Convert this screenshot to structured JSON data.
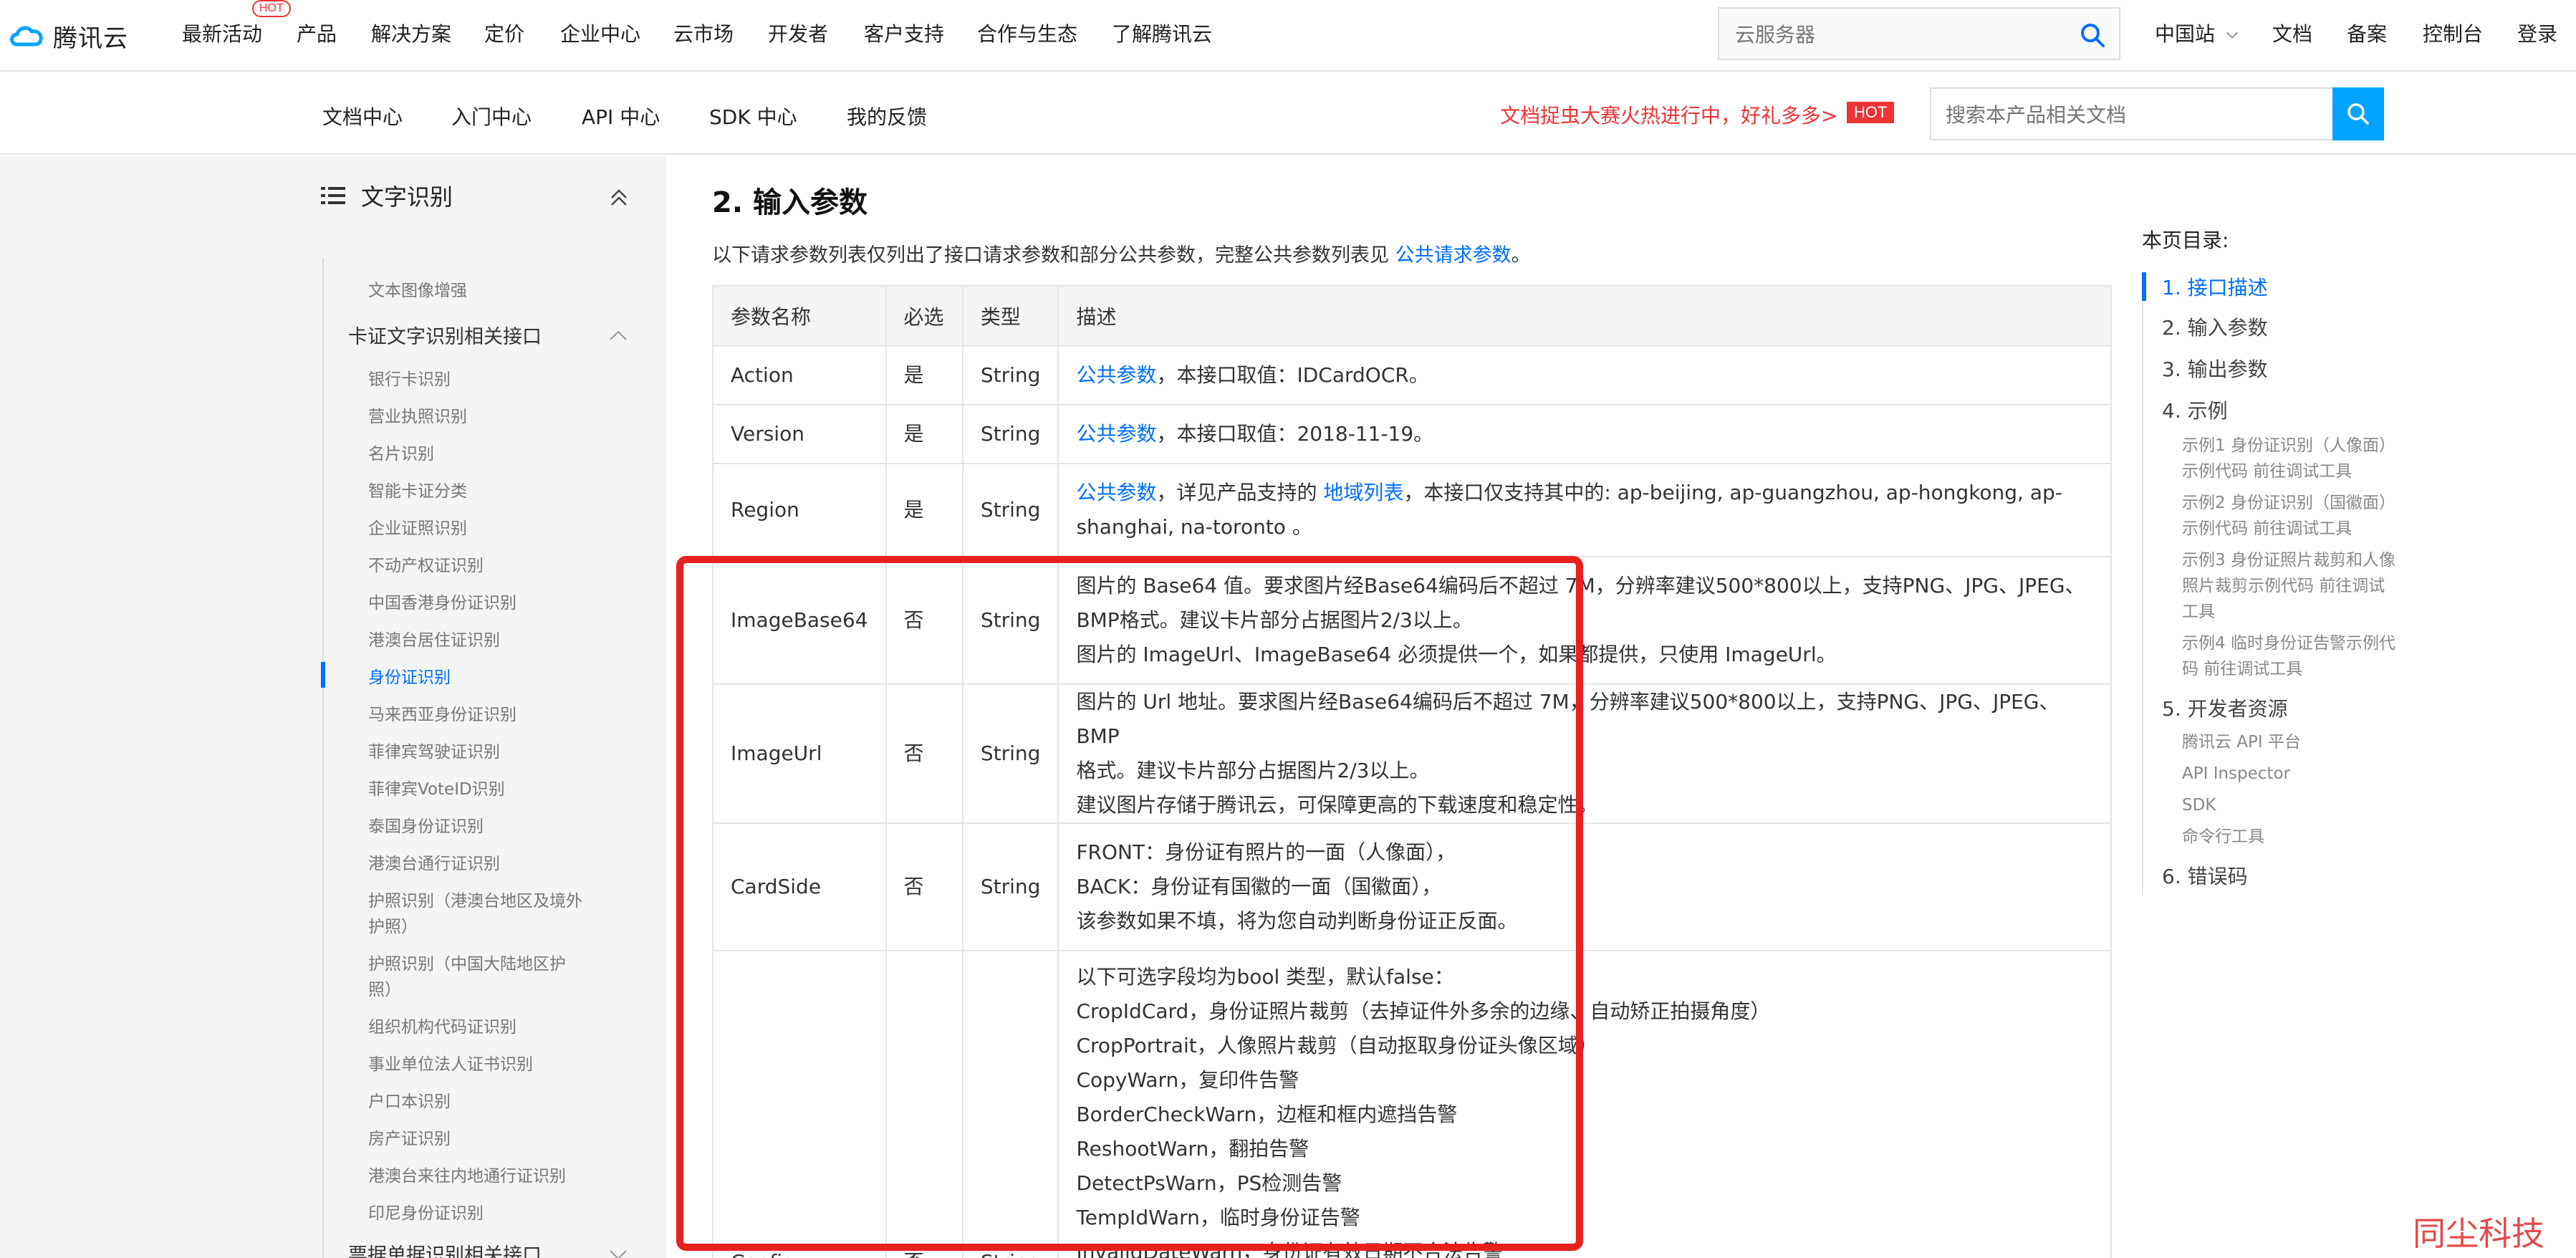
{
  "brand": {
    "name": "腾讯云",
    "accent": "#006eff",
    "highlight_color": "#e8201e"
  },
  "topnav": {
    "items": [
      "最新活动",
      "产品",
      "解决方案",
      "定价",
      "企业中心",
      "云市场",
      "开发者",
      "客户支持",
      "合作与生态",
      "了解腾讯云"
    ],
    "hot_badge": "HOT",
    "search_placeholder": "云服务器",
    "right": [
      "中国站",
      "文档",
      "备案",
      "控制台",
      "登录"
    ]
  },
  "subnav": {
    "items": [
      "文档中心",
      "入门中心",
      "API 中心",
      "SDK 中心",
      "我的反馈"
    ],
    "promo": "文档捉虫大赛火热进行中，好礼多多>",
    "promo_badge": "HOT",
    "search_placeholder": "搜索本产品相关文档"
  },
  "sidebar": {
    "title": "文字识别",
    "items": [
      {
        "label": "文本图像增强",
        "type": "item"
      },
      {
        "label": "卡证文字识别相关接口",
        "type": "group"
      },
      {
        "label": "银行卡识别",
        "type": "item"
      },
      {
        "label": "营业执照识别",
        "type": "item"
      },
      {
        "label": "名片识别",
        "type": "item"
      },
      {
        "label": "智能卡证分类",
        "type": "item"
      },
      {
        "label": "企业证照识别",
        "type": "item"
      },
      {
        "label": "不动产权证识别",
        "type": "item"
      },
      {
        "label": "中国香港身份证识别",
        "type": "item"
      },
      {
        "label": "港澳台居住证识别",
        "type": "item"
      },
      {
        "label": "身份证识别",
        "type": "item",
        "active": true
      },
      {
        "label": "马来西亚身份证识别",
        "type": "item"
      },
      {
        "label": "菲律宾驾驶证识别",
        "type": "item"
      },
      {
        "label": "菲律宾VoteID识别",
        "type": "item"
      },
      {
        "label": "泰国身份证识别",
        "type": "item"
      },
      {
        "label": "港澳台通行证识别",
        "type": "item"
      },
      {
        "label": "护照识别（港澳台地区及境外",
        "label2": "护照）",
        "type": "item"
      },
      {
        "label": "护照识别（中国大陆地区护",
        "label2": "照）",
        "type": "item"
      },
      {
        "label": "组织机构代码证识别",
        "type": "item"
      },
      {
        "label": "事业单位法人证书识别",
        "type": "item"
      },
      {
        "label": "户口本识别",
        "type": "item"
      },
      {
        "label": "房产证识别",
        "type": "item"
      },
      {
        "label": "港澳台来往内地通行证识别",
        "type": "item"
      },
      {
        "label": "印尼身份证识别",
        "type": "item"
      },
      {
        "label": "票据单据识别相关接口",
        "type": "group"
      }
    ]
  },
  "content": {
    "heading": "2. 输入参数",
    "intro_before": "以下请求参数列表仅列出了接口请求参数和部分公共参数，完整公共参数列表见 ",
    "intro_link": "公共请求参数",
    "intro_after": "。",
    "table": {
      "headers": [
        "参数名称",
        "必选",
        "类型",
        "描述"
      ],
      "rows": [
        {
          "name": "Action",
          "req": "是",
          "type": "String",
          "desc": [
            {
              "link": "公共参数",
              "text": "，本接口取值：IDCardOCR。"
            }
          ]
        },
        {
          "name": "Version",
          "req": "是",
          "type": "String",
          "desc": [
            {
              "link": "公共参数",
              "text": "，本接口取值：2018-11-19。"
            }
          ]
        },
        {
          "name": "Region",
          "req": "是",
          "type": "String",
          "desc": [
            {
              "link": "公共参数",
              "text": "，详见产品支持的 ",
              "link2": "地域列表",
              "text2": "，本接口仅支持其中的: ap-beijing, ap-guangzhou, ap-hongkong, ap-"
            },
            {
              "text": "shanghai, na-toronto 。"
            }
          ]
        },
        {
          "name": "ImageBase64",
          "req": "否",
          "type": "String",
          "desc": [
            {
              "text": "图片的 Base64 值。要求图片经Base64编码后不超过 7M，分辨率建议500*800以上，支持PNG、JPG、JPEG、"
            },
            {
              "text": "BMP格式。建议卡片部分占据图片2/3以上。"
            },
            {
              "text": "图片的 ImageUrl、ImageBase64 必须提供一个，如果都提供，只使用 ImageUrl。"
            }
          ]
        },
        {
          "name": "ImageUrl",
          "req": "否",
          "type": "String",
          "desc": [
            {
              "text": "图片的 Url 地址。要求图片经Base64编码后不超过 7M，分辨率建议500*800以上，支持PNG、JPG、JPEG、BMP"
            },
            {
              "text": "格式。建议卡片部分占据图片2/3以上。"
            },
            {
              "text": "建议图片存储于腾讯云，可保障更高的下载速度和稳定性。"
            }
          ]
        },
        {
          "name": "CardSide",
          "req": "否",
          "type": "String",
          "desc": [
            {
              "text": "FRONT：身份证有照片的一面（人像面），"
            },
            {
              "text": "BACK：身份证有国徽的一面（国徽面），"
            },
            {
              "text": "该参数如果不填，将为您自动判断身份证正反面。"
            }
          ]
        },
        {
          "name": "Config",
          "req": "否",
          "type": "String",
          "desc": [
            {
              "text": "以下可选字段均为bool 类型，默认false："
            },
            {
              "text": "CropIdCard，身份证照片裁剪（去掉证件外多余的边缘、自动矫正拍摄角度）"
            },
            {
              "text": "CropPortrait，人像照片裁剪（自动抠取身份证头像区域）"
            },
            {
              "text": "CopyWarn，复印件告警"
            },
            {
              "text": "BorderCheckWarn，边框和框内遮挡告警"
            },
            {
              "text": "ReshootWarn，翻拍告警"
            },
            {
              "text": "DetectPsWarn，PS检测告警"
            },
            {
              "text": "TempIdWarn，临时身份证告警"
            },
            {
              "text": "InvalidDateWarn，身份证有效日期不合法告警"
            }
          ]
        }
      ]
    }
  },
  "toc": {
    "title": "本页目录:",
    "items": [
      {
        "label": "1. 接口描述",
        "level": 1,
        "active": true
      },
      {
        "label": "2. 输入参数",
        "level": 1
      },
      {
        "label": "3. 输出参数",
        "level": 1
      },
      {
        "label": "4. 示例",
        "level": 1
      },
      {
        "label": "示例1 身份证识别（人像面）示例代码 前往调试工具",
        "level": 2
      },
      {
        "label": "示例2 身份证识别（国徽面）示例代码 前往调试工具",
        "level": 2
      },
      {
        "label": "示例3 身份证照片裁剪和人像照片裁剪示例代码 前往调试工具",
        "level": 2
      },
      {
        "label": "示例4 临时身份证告警示例代码 前往调试工具",
        "level": 2
      },
      {
        "label": "5. 开发者资源",
        "level": 1
      },
      {
        "label": "腾讯云 API 平台",
        "level": 2
      },
      {
        "label": "API Inspector",
        "level": 2
      },
      {
        "label": "SDK",
        "level": 2
      },
      {
        "label": "命令行工具",
        "level": 2
      },
      {
        "label": "6. 错误码",
        "level": 1
      }
    ]
  },
  "watermark": "同尘科技"
}
